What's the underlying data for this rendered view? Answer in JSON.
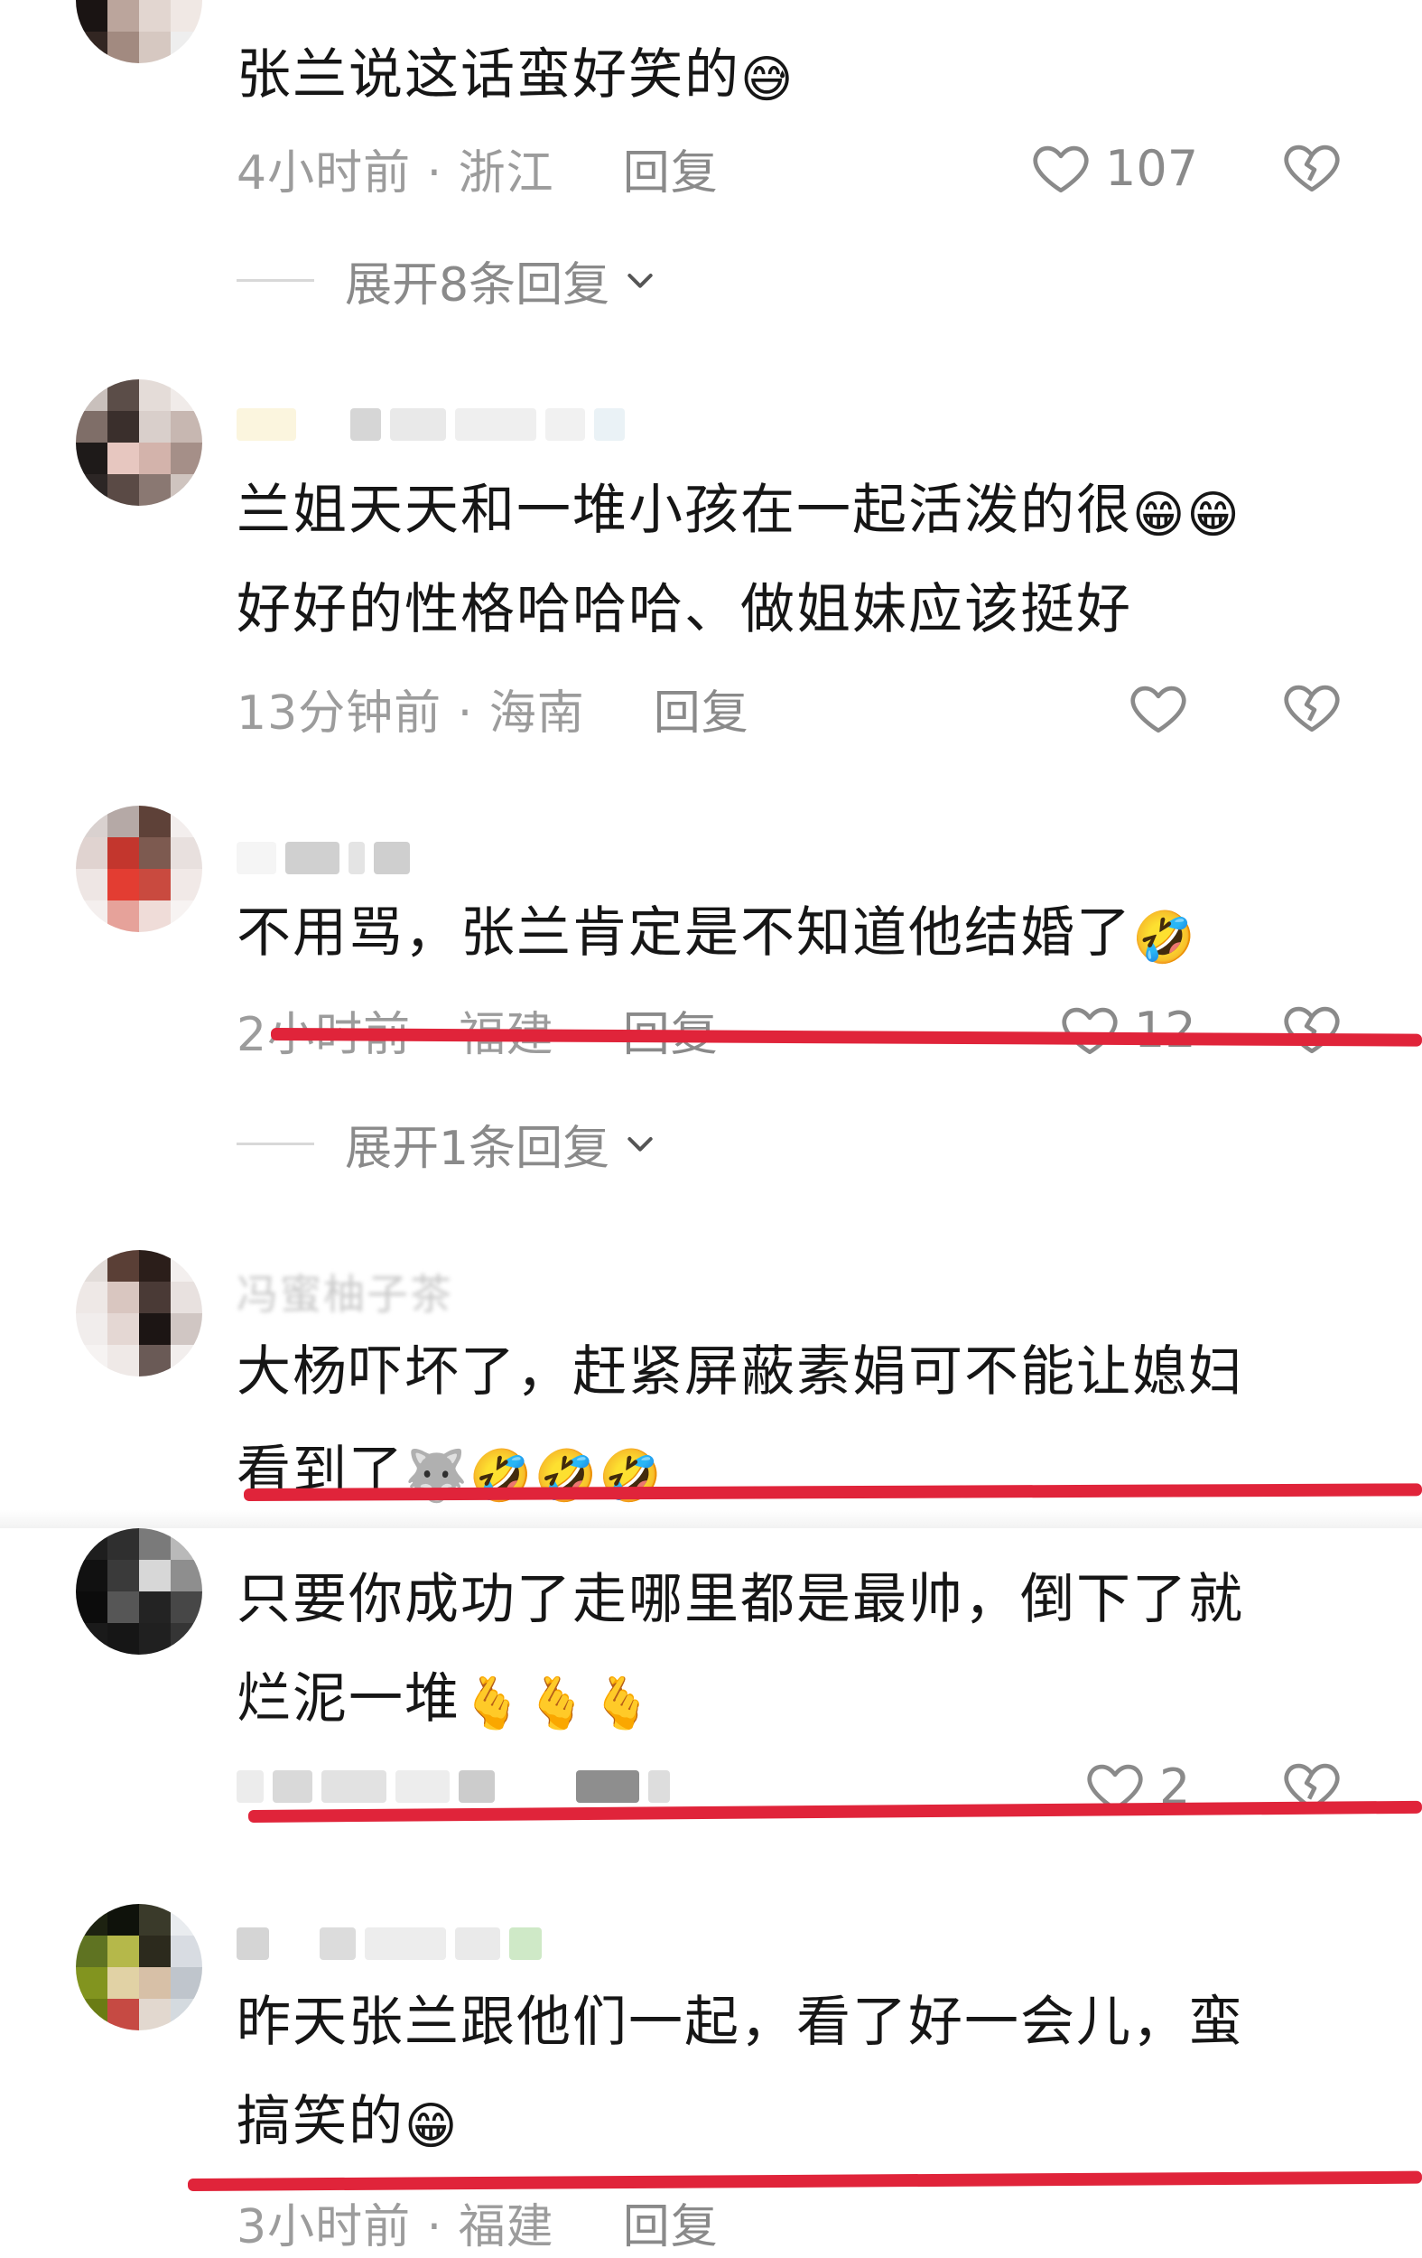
{
  "colors": {
    "strike": "#e0243a",
    "meta": "#9c9c9c",
    "text": "#161616"
  },
  "comments": [
    {
      "text": "张兰说这话蛮好笑的",
      "emojis": [
        "😅"
      ],
      "time": "4小时前 · 浙江",
      "reply": "回复",
      "likes": "107",
      "expand": "展开8条回复"
    },
    {
      "text_line1": "兰姐天天和一堆小孩在一起活泼的很",
      "text_line2": "好好的性格哈哈哈、做姐妹应该挺好",
      "emojis": [
        "😁",
        "😁"
      ],
      "time": "13分钟前 · 海南",
      "reply": "回复",
      "likes": ""
    },
    {
      "text": "不用骂，张兰肯定是不知道他结婚了",
      "emojis": [
        "🤣"
      ],
      "time": "2小时前 · 福建",
      "reply": "回复",
      "likes": "12",
      "expand": "展开1条回复"
    },
    {
      "username": "冯蜜柚子茶",
      "text_line1": "大杨吓坏了，赶紧屏蔽素娟可不能让媳妇",
      "text_line2": "看到了",
      "emojis": [
        "🐺",
        "🤣",
        "🤣",
        "🤣"
      ]
    },
    {
      "text_line1": "只要你成功了走哪里都是最帅，倒下了就",
      "text_line2": "烂泥一堆",
      "emojis": [
        "🫰",
        "🫰",
        "🫰"
      ],
      "likes": "2"
    },
    {
      "text_line1": "昨天张兰跟他们一起，看了好一会儿，蛮",
      "text_line2": "搞笑的",
      "emojis": [
        "😁"
      ],
      "time": "3小时前 · 福建",
      "reply": "回复"
    }
  ],
  "icons": {
    "like": "heart-outline-icon",
    "dislike": "broken-heart-icon",
    "expand": "chevron-down-icon"
  }
}
